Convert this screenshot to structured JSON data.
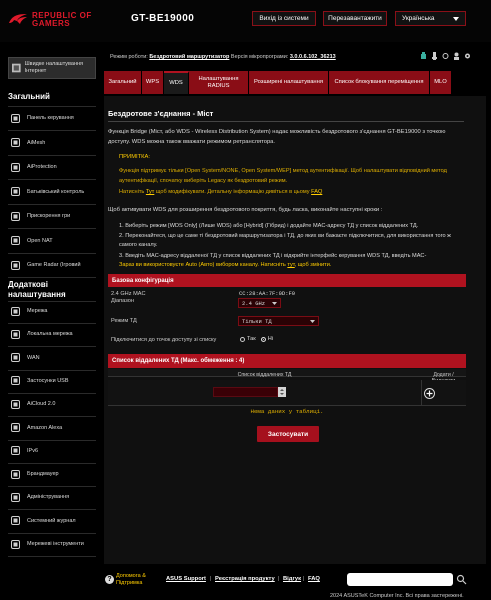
{
  "header": {
    "brand_line1": "REPUBLIC OF",
    "brand_line2": "GAMERS",
    "model": "GT-BE19000",
    "logout_label": "Вихід із системи",
    "reboot_label": "Перезавантажити",
    "language": "Українська",
    "accent_color": "#b0121f"
  },
  "status": {
    "mode_label": "Режим роботи:",
    "mode_value": "Бездротовий маршрутизатор",
    "fw_label": "Версія мікропрограми:",
    "fw_value": "3.0.0.6.102_36213"
  },
  "sidebar": {
    "qis_label": "Швидке налаштування Інтернет",
    "general_title": "Загальний",
    "general_items": [
      {
        "label": "Панель керування",
        "icon": "dashboard-icon"
      },
      {
        "label": "AiMesh",
        "icon": "aimesh-icon"
      },
      {
        "label": "AiProtection",
        "icon": "shield-icon"
      },
      {
        "label": "Батьківський контроль",
        "icon": "parental-icon"
      },
      {
        "label": "Прискорення гри",
        "icon": "game-boost-icon"
      },
      {
        "label": "Open NAT",
        "icon": "open-nat-icon"
      },
      {
        "label": "Game Radar (Ігровий",
        "icon": "game-radar-icon"
      }
    ],
    "advanced_title": "Додаткові налаштування",
    "advanced_items": [
      {
        "label": "Мережа",
        "icon": "network-icon"
      },
      {
        "label": "Локальна мережа",
        "icon": "lan-icon"
      },
      {
        "label": "WAN",
        "icon": "wan-icon"
      },
      {
        "label": "Застосунки USB",
        "icon": "usb-icon"
      },
      {
        "label": "AiCloud 2.0",
        "icon": "cloud-icon"
      },
      {
        "label": "Amazon Alexa",
        "icon": "alexa-icon"
      },
      {
        "label": "IPv6",
        "icon": "ipv6-icon"
      },
      {
        "label": "Брандмауер",
        "icon": "firewall-icon"
      },
      {
        "label": "Адміністрування",
        "icon": "admin-icon"
      },
      {
        "label": "Системний журнал",
        "icon": "log-icon"
      },
      {
        "label": "Мережеві інструменти",
        "icon": "tools-icon"
      }
    ]
  },
  "tabs": [
    {
      "label": "Загальний"
    },
    {
      "label": "WPS"
    },
    {
      "label": "WDS"
    },
    {
      "label": "Налаштування RADIUS"
    },
    {
      "label": "Розширені налаштування"
    },
    {
      "label": "Список блокування переміщення"
    },
    {
      "label": "MLO"
    }
  ],
  "main": {
    "title": "Бездротове з'єднання - Міст",
    "intro": "Функція Bridge (Міст, або WDS - Wireless Distribution System) надає можливість бездротового з'єднання GT-BE19000 з точкою доступу. WDS можна також вважати режимом ретранслятора.",
    "note_title": "ПРИМІТКА:",
    "note_line1": "Функція підтримує тільки [Open System/NONE, Open System/WEP] метод аутентифікації. Щоб налаштувати відповідний метод аутентифікації, спочатку виберіть Legacy як бездротовий режим.",
    "note_line2_prefix": "Натисніть ",
    "note_link1": "Тут",
    "note_line2_mid": " щоб модифікувати. Детальну інформацію дивіться в цьому ",
    "note_link2": "FAQ",
    "steps_intro": "Щоб активувати WDS для розширення бездротового покриття, будь ласка, виконайте наступні кроки :",
    "step1": "1. Виберіть режим [WDS Only] (Лише WDS) або [Hybrid] (Гібрид) і додайте MAC-адресу ТД у список віддалених ТД.",
    "step2": "2. Переконайтеся, що це саме ті бездротовий маршрутизатора і ТД, до яких ви бажаєте підключитися, для використання того ж самого каналу.",
    "step3_a": "3. Введіть MAC-адресу віддаленої ТД у список віддалених ТД і відкрийте інтерфейс керування WDS ТД, введіть MAC-",
    "step3_b": "Зараз ви використовуєте Auto (Авто) вибором каналу. Натисніть ",
    "step3_link": "тут",
    "step3_c": ", щоб змінити."
  },
  "basic_config": {
    "title": "Базова конфігурація",
    "mac_label_1": "2.4 GHz MAC",
    "mac_label_2": "Діапазон",
    "mac_value": "CC:28:AA:7F:0D:F0",
    "band_value": "2.4 GHz",
    "ap_mode_label": "Режим ТД",
    "ap_mode_value": "Тільки ТД",
    "connect_label": "Підключитися до точок доступу зі списку",
    "yes_label": "Так",
    "no_label": "Ні"
  },
  "remote_list": {
    "title": "Список віддалених ТД (Макс. обмеження : 4)",
    "col_list": "Список віддалених ТД",
    "col_action": "Додати / Видалити",
    "empty_text": "Нема даних у таблиці.",
    "apply_label": "Застосувати"
  },
  "footer": {
    "help_line1": "Допомога &",
    "help_line2": "Підтримка",
    "link_support": "ASUS Support",
    "link_register": "Реєстрація продукту",
    "link_feedback": "Відгук",
    "link_faq": "FAQ",
    "copyright": "2024 ASUSTeK Computer Inc. Всі права застережені."
  }
}
